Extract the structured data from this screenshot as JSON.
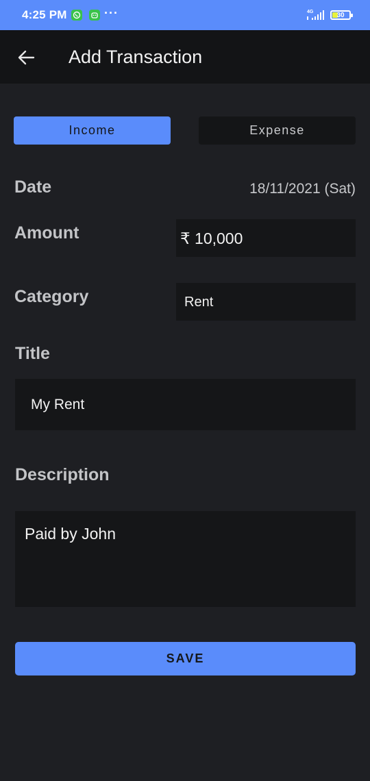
{
  "status_bar": {
    "time": "4:25 PM",
    "network": "4G",
    "battery": "30",
    "icons": [
      "whatsapp-icon",
      "android-notification-icon",
      "more-notifications-icon",
      "signal-icon",
      "battery-icon"
    ]
  },
  "app_bar": {
    "back_icon": "arrow-left-icon",
    "title": "Add Transaction"
  },
  "toggle": {
    "income": "Income",
    "expense": "Expense",
    "selected": "Income"
  },
  "form": {
    "date_label": "Date",
    "date_value": "18/11/2021 (Sat)",
    "amount_label": "Amount",
    "amount_value": "₹ 10,000",
    "category_label": "Category",
    "category_value": "Rent",
    "title_label": "Title",
    "title_value": "My Rent",
    "description_label": "Description",
    "description_value": "Paid by John"
  },
  "actions": {
    "save": "SAVE"
  },
  "colors": {
    "accent": "#5a8cfb",
    "background": "#1e1f23",
    "app_bar": "#131416",
    "input_background": "#151618",
    "label": "#c3c4c7"
  }
}
